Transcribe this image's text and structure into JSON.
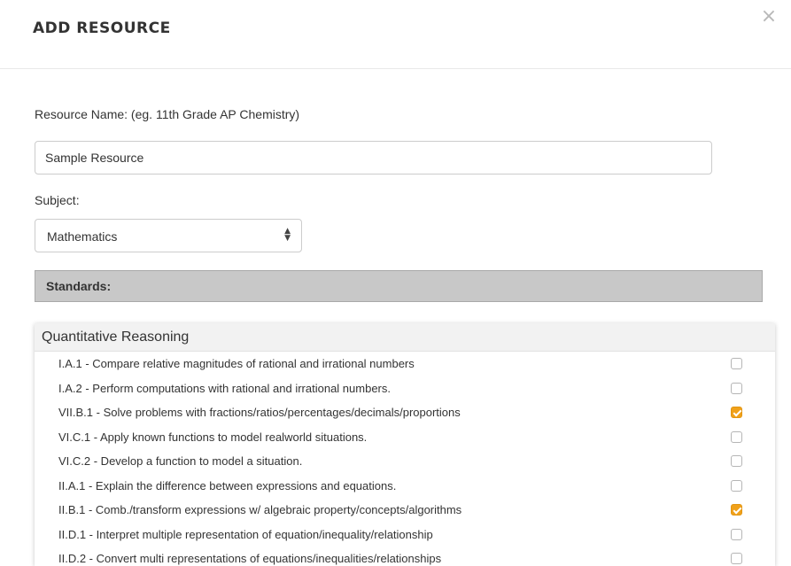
{
  "modal": {
    "title": "ADD RESOURCE",
    "close_symbol": "×"
  },
  "form": {
    "resource_name_label": "Resource Name: (eg. 11th Grade AP Chemistry)",
    "resource_name_value": "Sample Resource",
    "subject_label": "Subject:",
    "subject_value": "Mathematics",
    "select_arrows": "▲▼",
    "standards_header": "Standards:"
  },
  "standards": {
    "group_title": "Quantitative Reasoning",
    "items": [
      {
        "label": "I.A.1 - Compare relative magnitudes of rational and irrational numbers",
        "checked": false
      },
      {
        "label": "I.A.2 - Perform computations with rational and irrational numbers.",
        "checked": false
      },
      {
        "label": "VII.B.1 - Solve problems with fractions/ratios/percentages/decimals/proportions",
        "checked": true
      },
      {
        "label": "VI.C.1 - Apply known functions to model realworld situations.",
        "checked": false
      },
      {
        "label": "VI.C.2 - Develop a function to model a situation.",
        "checked": false
      },
      {
        "label": "II.A.1 - Explain the difference between expressions and equations.",
        "checked": false
      },
      {
        "label": "II.B.1 - Comb./transform expressions w/ algebraic property/concepts/algorithms",
        "checked": true
      },
      {
        "label": "II.D.1 - Interpret multiple representation of equation/inequality/relationship",
        "checked": false
      },
      {
        "label": "II.D.2 - Convert multi representations of equations/inequalities/relationships",
        "checked": false
      }
    ]
  },
  "colors": {
    "checked_accent": "#f0a11a",
    "standards_bar": "#c8c8c8"
  }
}
